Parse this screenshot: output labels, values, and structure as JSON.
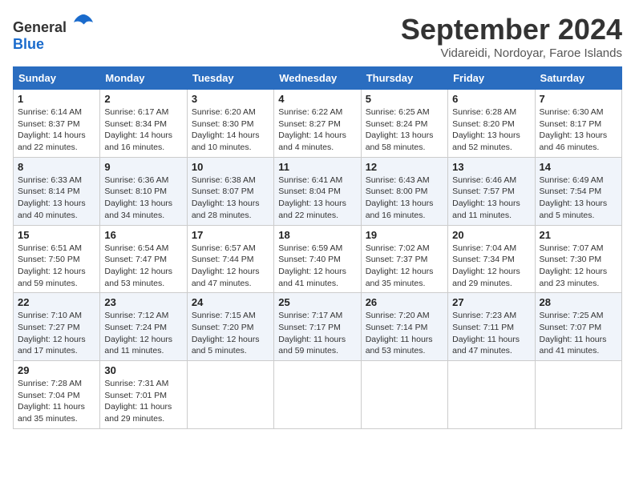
{
  "logo": {
    "text_general": "General",
    "text_blue": "Blue"
  },
  "title": "September 2024",
  "location": "Vidareidi, Nordoyar, Faroe Islands",
  "weekdays": [
    "Sunday",
    "Monday",
    "Tuesday",
    "Wednesday",
    "Thursday",
    "Friday",
    "Saturday"
  ],
  "weeks": [
    [
      {
        "day": "1",
        "info": "Sunrise: 6:14 AM\nSunset: 8:37 PM\nDaylight: 14 hours\nand 22 minutes."
      },
      {
        "day": "2",
        "info": "Sunrise: 6:17 AM\nSunset: 8:34 PM\nDaylight: 14 hours\nand 16 minutes."
      },
      {
        "day": "3",
        "info": "Sunrise: 6:20 AM\nSunset: 8:30 PM\nDaylight: 14 hours\nand 10 minutes."
      },
      {
        "day": "4",
        "info": "Sunrise: 6:22 AM\nSunset: 8:27 PM\nDaylight: 14 hours\nand 4 minutes."
      },
      {
        "day": "5",
        "info": "Sunrise: 6:25 AM\nSunset: 8:24 PM\nDaylight: 13 hours\nand 58 minutes."
      },
      {
        "day": "6",
        "info": "Sunrise: 6:28 AM\nSunset: 8:20 PM\nDaylight: 13 hours\nand 52 minutes."
      },
      {
        "day": "7",
        "info": "Sunrise: 6:30 AM\nSunset: 8:17 PM\nDaylight: 13 hours\nand 46 minutes."
      }
    ],
    [
      {
        "day": "8",
        "info": "Sunrise: 6:33 AM\nSunset: 8:14 PM\nDaylight: 13 hours\nand 40 minutes."
      },
      {
        "day": "9",
        "info": "Sunrise: 6:36 AM\nSunset: 8:10 PM\nDaylight: 13 hours\nand 34 minutes."
      },
      {
        "day": "10",
        "info": "Sunrise: 6:38 AM\nSunset: 8:07 PM\nDaylight: 13 hours\nand 28 minutes."
      },
      {
        "day": "11",
        "info": "Sunrise: 6:41 AM\nSunset: 8:04 PM\nDaylight: 13 hours\nand 22 minutes."
      },
      {
        "day": "12",
        "info": "Sunrise: 6:43 AM\nSunset: 8:00 PM\nDaylight: 13 hours\nand 16 minutes."
      },
      {
        "day": "13",
        "info": "Sunrise: 6:46 AM\nSunset: 7:57 PM\nDaylight: 13 hours\nand 11 minutes."
      },
      {
        "day": "14",
        "info": "Sunrise: 6:49 AM\nSunset: 7:54 PM\nDaylight: 13 hours\nand 5 minutes."
      }
    ],
    [
      {
        "day": "15",
        "info": "Sunrise: 6:51 AM\nSunset: 7:50 PM\nDaylight: 12 hours\nand 59 minutes."
      },
      {
        "day": "16",
        "info": "Sunrise: 6:54 AM\nSunset: 7:47 PM\nDaylight: 12 hours\nand 53 minutes."
      },
      {
        "day": "17",
        "info": "Sunrise: 6:57 AM\nSunset: 7:44 PM\nDaylight: 12 hours\nand 47 minutes."
      },
      {
        "day": "18",
        "info": "Sunrise: 6:59 AM\nSunset: 7:40 PM\nDaylight: 12 hours\nand 41 minutes."
      },
      {
        "day": "19",
        "info": "Sunrise: 7:02 AM\nSunset: 7:37 PM\nDaylight: 12 hours\nand 35 minutes."
      },
      {
        "day": "20",
        "info": "Sunrise: 7:04 AM\nSunset: 7:34 PM\nDaylight: 12 hours\nand 29 minutes."
      },
      {
        "day": "21",
        "info": "Sunrise: 7:07 AM\nSunset: 7:30 PM\nDaylight: 12 hours\nand 23 minutes."
      }
    ],
    [
      {
        "day": "22",
        "info": "Sunrise: 7:10 AM\nSunset: 7:27 PM\nDaylight: 12 hours\nand 17 minutes."
      },
      {
        "day": "23",
        "info": "Sunrise: 7:12 AM\nSunset: 7:24 PM\nDaylight: 12 hours\nand 11 minutes."
      },
      {
        "day": "24",
        "info": "Sunrise: 7:15 AM\nSunset: 7:20 PM\nDaylight: 12 hours\nand 5 minutes."
      },
      {
        "day": "25",
        "info": "Sunrise: 7:17 AM\nSunset: 7:17 PM\nDaylight: 11 hours\nand 59 minutes."
      },
      {
        "day": "26",
        "info": "Sunrise: 7:20 AM\nSunset: 7:14 PM\nDaylight: 11 hours\nand 53 minutes."
      },
      {
        "day": "27",
        "info": "Sunrise: 7:23 AM\nSunset: 7:11 PM\nDaylight: 11 hours\nand 47 minutes."
      },
      {
        "day": "28",
        "info": "Sunrise: 7:25 AM\nSunset: 7:07 PM\nDaylight: 11 hours\nand 41 minutes."
      }
    ],
    [
      {
        "day": "29",
        "info": "Sunrise: 7:28 AM\nSunset: 7:04 PM\nDaylight: 11 hours\nand 35 minutes."
      },
      {
        "day": "30",
        "info": "Sunrise: 7:31 AM\nSunset: 7:01 PM\nDaylight: 11 hours\nand 29 minutes."
      },
      null,
      null,
      null,
      null,
      null
    ]
  ]
}
